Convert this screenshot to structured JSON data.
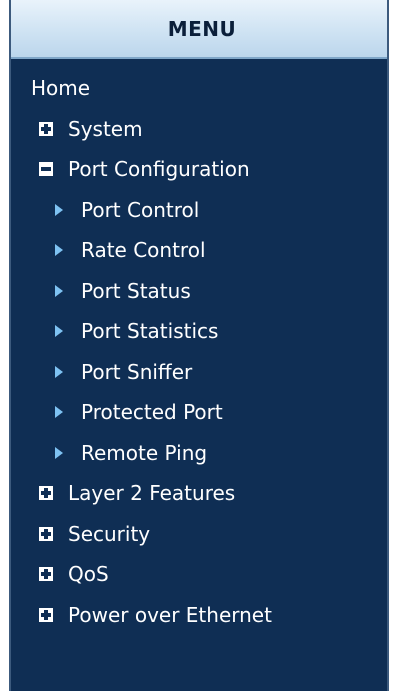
{
  "menu": {
    "title": "MENU",
    "home": "Home",
    "groups": [
      {
        "label": "System",
        "expanded": false
      },
      {
        "label": "Port Configuration",
        "expanded": true,
        "items": [
          "Port Control",
          "Rate Control",
          "Port Status",
          "Port Statistics",
          "Port Sniffer",
          "Protected Port",
          "Remote Ping"
        ]
      },
      {
        "label": "Layer 2 Features",
        "expanded": false
      },
      {
        "label": "Security",
        "expanded": false
      },
      {
        "label": "QoS",
        "expanded": false
      },
      {
        "label": "Power over Ethernet",
        "expanded": false
      }
    ]
  },
  "icons": {
    "collapsed": "plus-box-icon",
    "expanded": "minus-box-icon",
    "subitem": "triangle-right-icon"
  },
  "colors": {
    "panel_background": "#0f2e54",
    "header_background": "#cfe3f3",
    "header_text": "#0b1f3a",
    "menu_text": "#ffffff",
    "arrow": "#7ec2f2"
  }
}
